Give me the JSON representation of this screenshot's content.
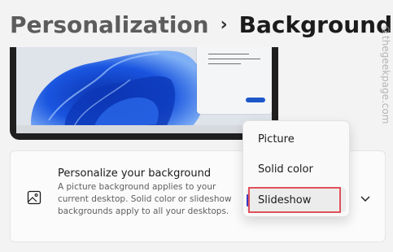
{
  "breadcrumb": {
    "parent": "Personalization",
    "separator": "›",
    "current": "Background"
  },
  "watermark": "©thegeekpage.com",
  "card": {
    "title": "Personalize your background",
    "description": "A picture background applies to your current desktop. Solid color or slideshow backgrounds apply to all your desktops."
  },
  "dropdown": {
    "options": [
      "Picture",
      "Solid color",
      "Slideshow"
    ],
    "selected": "Slideshow"
  },
  "icons": {
    "card": "image-icon",
    "expand": "chevron-down-icon"
  },
  "colors": {
    "accent": "#3b38c4",
    "highlight": "#e0505a",
    "preview_button": "#1e57c9"
  }
}
